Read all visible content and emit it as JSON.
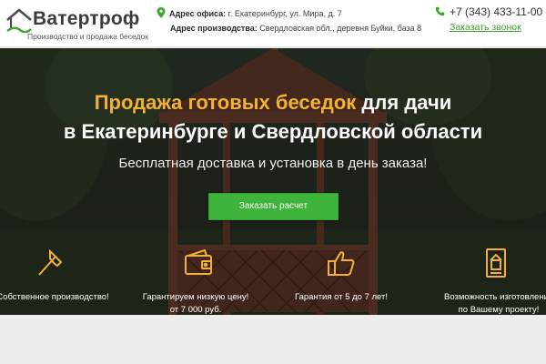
{
  "colors": {
    "accent_orange": "#f3b231",
    "cta_green": "#3fb43a",
    "link_green": "#3fa62e",
    "header_bg": "#ffffff",
    "hero_overlay": "#1a1d16"
  },
  "header": {
    "logo": {
      "title": "Ватертроф",
      "subtitle": "Производство и продажа беседок",
      "icon": "house-roof-logo-icon"
    },
    "office_address": {
      "label": "Адрес офиса:",
      "value": "г. Екатеринбург, ул. Мира, д. 7",
      "icon": "map-pin-icon"
    },
    "production_address": {
      "label": "Адрес производства:",
      "value": "Свердловская обл., деревня Буйки, база 8"
    },
    "phone": {
      "number": "+7 (343) 433-11-00",
      "icon": "phone-icon"
    },
    "callback_link": "Заказать звонок"
  },
  "hero": {
    "headline_accent": "Продажа готовых беседок",
    "headline_rest1": " для дачи",
    "headline_line2": "в Екатеринбурге и Свердловской области",
    "subline": "Бесплатная доставка и установка в день заказа!",
    "cta_label": "Заказать расчет"
  },
  "features": [
    {
      "icon": "axe-icon",
      "line1": "Собственное производство!",
      "line2": ""
    },
    {
      "icon": "wallet-icon",
      "line1": "Гарантируем низкую цену!",
      "line2": "от 7 000 руб."
    },
    {
      "icon": "thumbs-up-icon",
      "line1": "Гарантия от 5 до 7 лет!",
      "line2": ""
    },
    {
      "icon": "blueprint-icon",
      "line1": "Возможность изготовления",
      "line2": "по Вашему проекту!"
    }
  ]
}
